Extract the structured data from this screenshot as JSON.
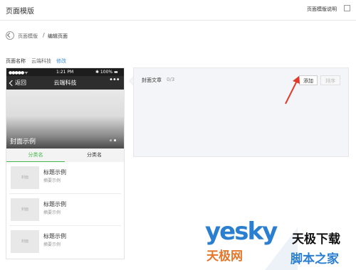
{
  "header": {
    "title": "页面模版",
    "help_label": "页面模版说明"
  },
  "breadcrumb": {
    "parent": "页面模版",
    "separator": "/",
    "current": "编辑页面"
  },
  "page_name": {
    "label": "页面名称",
    "value": "云端科技",
    "edit": "修改"
  },
  "phone": {
    "status": {
      "carrier": "●●●●● ᯤ",
      "time": "1:21 PM",
      "battery": "✱ 100% ▬"
    },
    "nav": {
      "back": "返回",
      "title": "云端科技",
      "more": "•••"
    },
    "cover_label": "封面示例",
    "tabs": [
      "分类名",
      "分类名"
    ],
    "items": [
      {
        "thumb": "封面",
        "title": "标题示例",
        "summary": "摘要示例"
      },
      {
        "thumb": "封面",
        "title": "标题示例",
        "summary": "摘要示例"
      },
      {
        "thumb": "封面",
        "title": "标题示例",
        "summary": "摘要示例"
      }
    ]
  },
  "panel": {
    "label": "封面文章",
    "count": "0/3",
    "add": "添加",
    "sort": "排序"
  },
  "watermark": {
    "brand": "yesky",
    "cn1": "天极下载",
    "cn2": "天极网",
    "cn3": "脚本之家"
  },
  "colors": {
    "accent_green": "#44b549",
    "link_blue": "#3d8fd6"
  }
}
